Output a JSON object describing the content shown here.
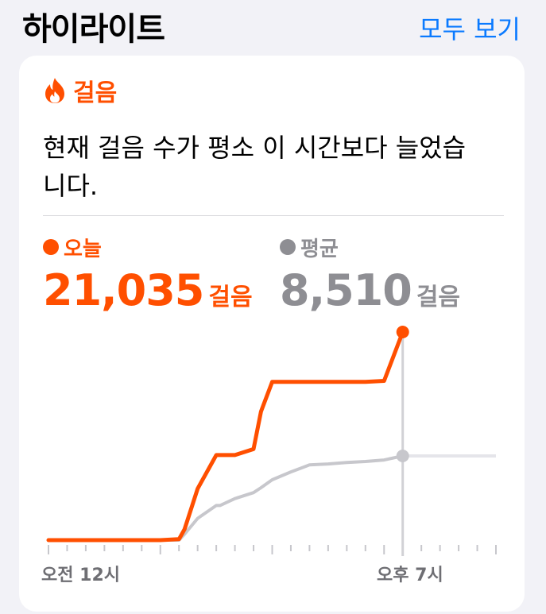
{
  "header": {
    "title": "하이라이트",
    "see_all": "모두 보기"
  },
  "card": {
    "category": "걸음",
    "category_icon": "flame-icon",
    "message": "현재 걸음 수가 평소 이 시간보다 늘었습니다.",
    "today": {
      "legend": "오늘",
      "value": "21,035",
      "unit": "걸음",
      "color": "#ff4f00"
    },
    "average": {
      "legend": "평균",
      "value": "8,510",
      "unit": "걸음",
      "color": "#8e8e93"
    }
  },
  "chart_data": {
    "type": "line",
    "x_tick_labels": [
      "오전 12시",
      "오후 7시"
    ],
    "x_hours": [
      0,
      1,
      2,
      3,
      4,
      5,
      6,
      7,
      7.3,
      8,
      9,
      9.2,
      10,
      11,
      11.4,
      12,
      13,
      14,
      15,
      16,
      17,
      18,
      19
    ],
    "series": [
      {
        "name": "오늘",
        "color": "#ff4f00",
        "values": [
          0,
          0,
          0,
          0,
          0,
          0,
          0,
          100,
          1100,
          5200,
          8600,
          8600,
          8600,
          9200,
          13000,
          16000,
          16000,
          16000,
          16000,
          16000,
          16000,
          16100,
          21035
        ]
      },
      {
        "name": "평균",
        "color": "#c7c7cc",
        "values": [
          0,
          0,
          0,
          0,
          0,
          0,
          0,
          0,
          600,
          2200,
          3500,
          3500,
          4200,
          4800,
          5300,
          6100,
          6900,
          7600,
          7700,
          7850,
          7950,
          8100,
          8510
        ]
      }
    ],
    "current_hour": 19,
    "x_range": [
      0,
      24
    ],
    "y_range": [
      0,
      21035
    ]
  }
}
